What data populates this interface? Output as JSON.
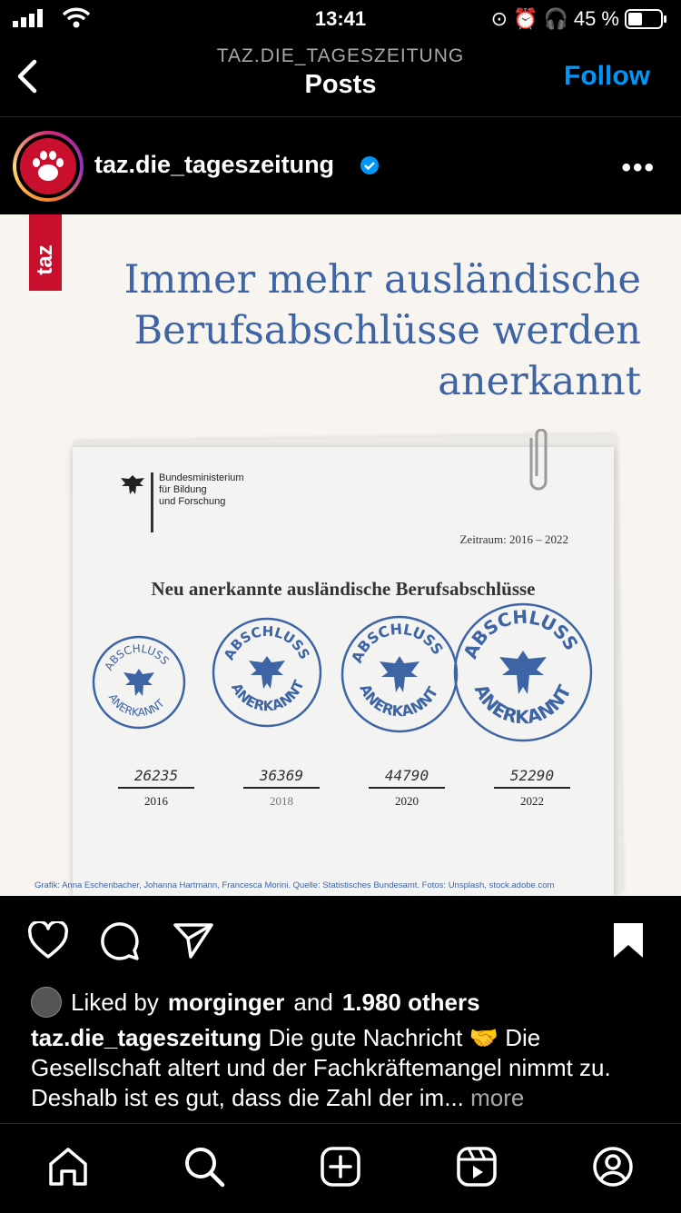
{
  "status_bar": {
    "time": "13:41",
    "battery": "45 %"
  },
  "header": {
    "subtitle": "TAZ.DIE_TAGESZEITUNG",
    "title": "Posts",
    "follow_label": "Follow"
  },
  "post": {
    "account": "taz.die_tageszeitung",
    "image": {
      "logo_text": "taz",
      "headline": [
        "Immer mehr ausländische",
        "Berufsabschlüsse werden",
        "anerkannt"
      ],
      "ministry": [
        "Bundesministerium",
        "für Bildung",
        "und Forschung"
      ],
      "period": "Zeitraum: 2016 – 2022",
      "doc_title": "Neu anerkannte ausländische Berufsabschlüsse",
      "stamp_text": [
        "ABSCHLUSS",
        "ANERKANNT"
      ],
      "figures": [
        {
          "value": "26235",
          "year": "2016"
        },
        {
          "value": "36369",
          "year": "2018"
        },
        {
          "value": "44790",
          "year": "2020"
        },
        {
          "value": "52290",
          "year": "2022"
        }
      ],
      "credit": "Grafik: Anna Eschenbacher, Johanna Hartmann, Francesca Morini. Quelle: Statistisches Bundesamt. Fotos: Unsplash, stock.adobe.com"
    },
    "likes": {
      "prefix": "Liked by",
      "user": "morginger",
      "middle": "and",
      "count": "1.980 others"
    },
    "caption": {
      "user": "taz.die_tageszeitung",
      "text": "Die gute Nachricht 🤝 Die Gesellschaft altert und der Fachkräftemangel nimmt zu. Deshalb ist es gut, dass die Zahl der im...",
      "more": "more"
    }
  }
}
